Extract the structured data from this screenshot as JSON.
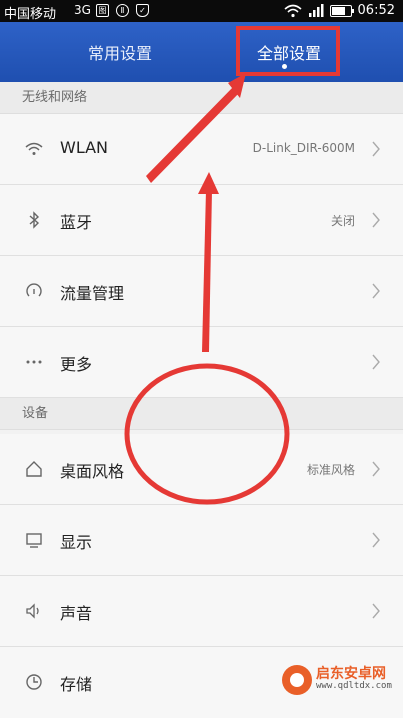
{
  "status_bar": {
    "carrier": "中国移动",
    "network": "3G",
    "time": "06:52",
    "battery_level": 0.85
  },
  "tabs": {
    "common": "常用设置",
    "all": "全部设置",
    "active": "all"
  },
  "sections": {
    "wireless": {
      "header": "无线和网络",
      "items": [
        {
          "label": "WLAN",
          "value": "D-Link_DIR-600M",
          "icon": "wifi-icon"
        },
        {
          "label": "蓝牙",
          "value": "关闭",
          "icon": "bluetooth-icon"
        },
        {
          "label": "流量管理",
          "value": "",
          "icon": "data-usage-icon"
        },
        {
          "label": "更多",
          "value": "",
          "icon": "more-icon"
        }
      ]
    },
    "device": {
      "header": "设备",
      "items": [
        {
          "label": "桌面风格",
          "value": "标准风格",
          "icon": "home-icon"
        },
        {
          "label": "显示",
          "value": "",
          "icon": "display-icon"
        },
        {
          "label": "声音",
          "value": "",
          "icon": "speaker-icon"
        },
        {
          "label": "存储",
          "value": "",
          "icon": "storage-icon"
        }
      ]
    }
  },
  "annotation": {
    "color": "#e53935"
  },
  "watermark": {
    "title": "启东安卓网",
    "url": "www.qdltdx.com"
  },
  "colors": {
    "tabbar": "#2656bb",
    "background": "#f2f2f2"
  }
}
